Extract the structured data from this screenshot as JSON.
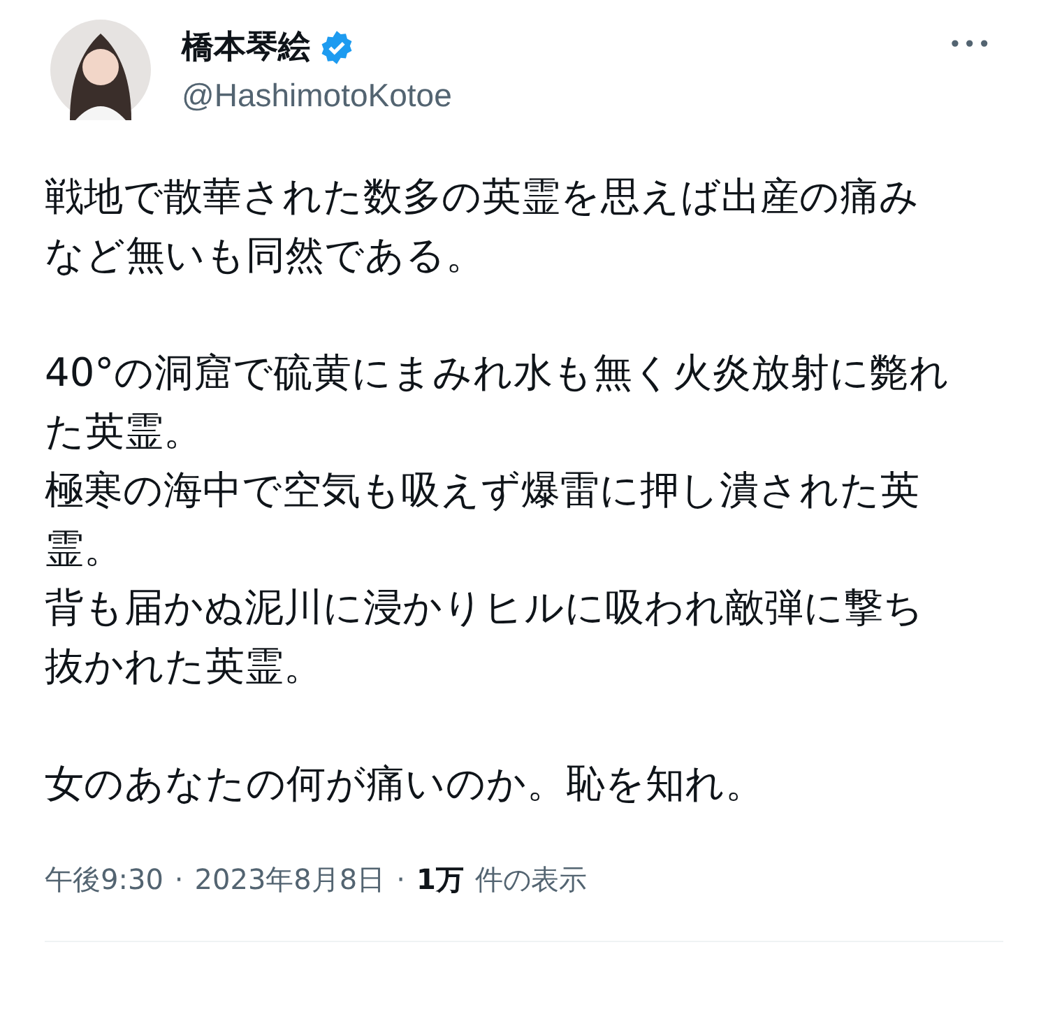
{
  "author": {
    "name": "橋本琴絵",
    "verified": true,
    "handle": "@HashimotoKotoe"
  },
  "menu": "•••",
  "body": [
    {
      "lines": [
        "戦地で散華された数多の英霊を思えば出産の痛み",
        "など無いも同然である。"
      ]
    },
    {
      "lines": [
        "40°の洞窟で硫黄にまみれ水も無く火炎放射に斃れ",
        "た英霊。",
        "極寒の海中で空気も吸えず爆雷に押し潰された英",
        "霊。",
        "背も届かぬ泥川に浸かりヒルに吸われ敵弾に撃ち",
        "抜かれた英霊。"
      ]
    },
    {
      "lines": [
        "女のあなたの何が痛いのか。恥を知れ。"
      ]
    }
  ],
  "meta": {
    "time": "午後9:30",
    "separator_1": "·",
    "date": "2023年8月8日",
    "separator_2": "·",
    "views_count": "1万",
    "views_label": "件の表示"
  }
}
